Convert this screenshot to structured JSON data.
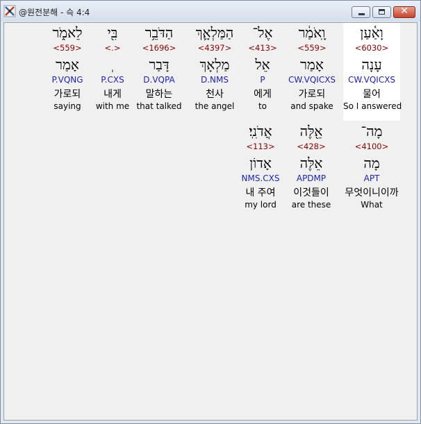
{
  "window": {
    "title": "@원전분해 - 슥 4:4",
    "app_icon": "cross-tools-icon",
    "close_label": "✕",
    "accent_close": "#c9432b"
  },
  "rows": [
    {
      "words": [
        {
          "heb": "וָאַ֫עַן",
          "strong": "<6030>",
          "lemma": "עָנָה",
          "morph": "CW.VQICXS",
          "kor": "물어",
          "eng": "So I answered",
          "selected": true
        },
        {
          "heb": "וָֽאֹמַ֔ר",
          "strong": "<559>",
          "lemma": "אָמַר",
          "morph": "CW.VQICXS",
          "kor": "가로되",
          "eng": "and spake"
        },
        {
          "heb": "אֶל־",
          "strong": "<413>",
          "lemma": "אֵל",
          "morph": "P",
          "kor": "에게",
          "eng": "to"
        },
        {
          "heb": "הַמַּלְאָ֛ךְ",
          "strong": "<4397>",
          "lemma": "מַלְאָךְ",
          "morph": "D.NMS",
          "kor": "천사",
          "eng": "the angel"
        },
        {
          "heb": "הַדֹּבֵ֥ר",
          "strong": "<1696>",
          "lemma": "דָּבַר",
          "morph": "D.VQPA",
          "kor": "말하는",
          "eng": "that talked"
        },
        {
          "heb": "בִּ֖י",
          "strong": "<.>",
          "lemma": "ְ",
          "morph": "P.CXS",
          "kor": "내게",
          "eng": "with me"
        },
        {
          "heb": "לֵאמֹ֑ר",
          "strong": "<559>",
          "lemma": "אָמַר",
          "morph": "P.VQNG",
          "kor": "가로되",
          "eng": "saying"
        }
      ]
    },
    {
      "words": [
        {
          "heb": "מָה־",
          "strong": "<4100>",
          "lemma": "מָה",
          "morph": "APT",
          "kor": "무엇이니이까",
          "eng": "What"
        },
        {
          "heb": "אֵ֖לֶּה",
          "strong": "<428>",
          "lemma": "אֵלֶּה",
          "morph": "APDMP",
          "kor": "이것들이",
          "eng": "are these"
        },
        {
          "heb": "אֲדֹנִֽי׃",
          "strong": "<113>",
          "lemma": "אָדוֹן",
          "morph": "NMS.CXS",
          "kor": "내 주여",
          "eng": "my lord"
        }
      ]
    }
  ]
}
